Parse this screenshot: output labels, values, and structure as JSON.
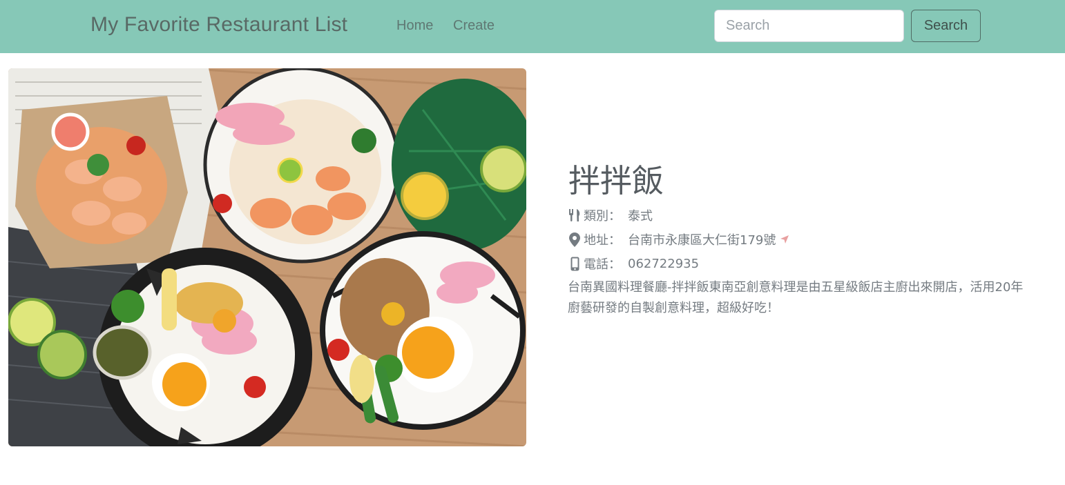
{
  "navbar": {
    "brand": "My Favorite Restaurant List",
    "links": [
      {
        "label": "Home"
      },
      {
        "label": "Create"
      }
    ],
    "search": {
      "placeholder": "Search",
      "value": "",
      "button_label": "Search"
    },
    "background_color": "#86c8b7"
  },
  "restaurant": {
    "name": "拌拌飯",
    "category_label": "類別：",
    "category": "泰式",
    "address_label": "地址：",
    "address": "台南市永康區大仁街179號",
    "phone_label": "電話：",
    "phone": "062722935",
    "description": "台南異國料理餐廳-拌拌飯東南亞創意料理是由五星級飯店主廚出來開店，活用20年廚藝研發的自製創意料理，超級好吃！",
    "icons": {
      "category": "utensils-icon",
      "address": "map-marker-icon",
      "phone": "mobile-phone-icon",
      "directions": "location-arrow-icon"
    },
    "accent_color": "#e8a0a0"
  }
}
